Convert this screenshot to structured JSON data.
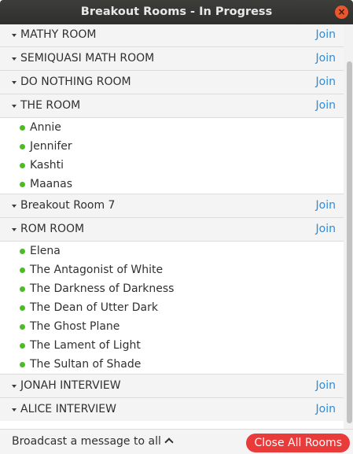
{
  "window": {
    "title": "Breakout Rooms - In Progress",
    "close_glyph": "×"
  },
  "rooms": [
    {
      "name": "MATHY ROOM",
      "join": "Join",
      "members": []
    },
    {
      "name": "SEMIQUASI MATH ROOM",
      "join": "Join",
      "members": []
    },
    {
      "name": "DO NOTHING ROOM",
      "join": "Join",
      "members": []
    },
    {
      "name": "THE ROOM",
      "join": "Join",
      "members": [
        "Annie",
        "Jennifer",
        "Kashti",
        "Maanas"
      ]
    },
    {
      "name": "Breakout Room 7",
      "join": "Join",
      "members": []
    },
    {
      "name": "ROM ROOM",
      "join": "Join",
      "members": [
        "Elena",
        "The Antagonist of White",
        "The Darkness of Darkness",
        "The Dean of Utter Dark",
        "The Ghost Plane",
        "The Lament of Light",
        "The Sultan of Shade"
      ]
    },
    {
      "name": "JONAH INTERVIEW",
      "join": "Join",
      "members": []
    },
    {
      "name": "ALICE INTERVIEW",
      "join": "Join",
      "members": []
    }
  ],
  "footer": {
    "broadcast_label": "Broadcast a message to all",
    "close_all_label": "Close All Rooms"
  },
  "colors": {
    "join": "#2d8cd9",
    "online_dot": "#4bbd23",
    "close_all": "#ea3b3b"
  }
}
